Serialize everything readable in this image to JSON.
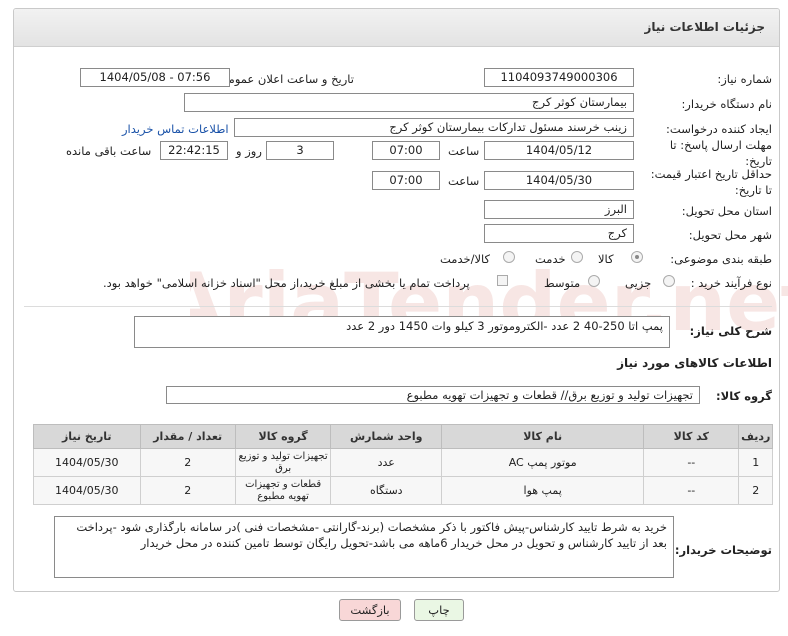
{
  "page": {
    "title": "جزئیات اطلاعات نیاز"
  },
  "fields": {
    "need_number_label": "شماره نیاز:",
    "need_number": "1104093749000306",
    "announce_label": "تاریخ و ساعت اعلان عمومی:",
    "announce_value": "1404/05/08 - 07:56",
    "buyer_org_label": "نام دستگاه خریدار:",
    "buyer_org": "بیمارستان کوثر کرج",
    "creator_label": "ایجاد کننده درخواست:",
    "creator": "زینب خرسند مسئول تدارکات بیمارستان کوثر کرج",
    "contact_link": "اطلاعات تماس خریدار",
    "deadline_label_1": "مهلت ارسال پاسخ: تا",
    "deadline_label_2": "تاریخ:",
    "deadline_date": "1404/05/12",
    "time_label": "ساعت",
    "deadline_time": "07:00",
    "days_value": "3",
    "days_label": "روز و",
    "remaining_time": "22:42:15",
    "remaining_label": "ساعت باقی مانده",
    "min_price_label_1": "حداقل تاریخ اعتبار قیمت:",
    "min_price_label_2": "تا تاریخ:",
    "price_date": "1404/05/30",
    "price_time": "07:00",
    "province_label": "استان محل تحویل:",
    "province": "البرز",
    "city_label": "شهر محل تحویل:",
    "city": "کرج",
    "category_label": "طبقه بندی موضوعی:",
    "category_options": [
      "کالا",
      "خدمت",
      "کالا/خدمت"
    ],
    "process_label": "نوع فرآیند خرید :",
    "process_options": [
      "جزیی",
      "متوسط"
    ],
    "payment_note": "پرداخت تمام یا بخشی از مبلغ خرید،از محل \"اسناد خزانه اسلامی\" خواهد بود."
  },
  "description": {
    "label": "شرح کلی نیاز:",
    "text": "پمپ اتا 250-40 2 عدد -الکتروموتور 3 کیلو وات 1450 دور 2 عدد"
  },
  "goods_info": {
    "heading": "اطلاعات کالاهای مورد نیاز",
    "group_label": "گروه کالا:",
    "group_value": "تجهیزات تولید و توزیع برق//  قطعات و تجهیزات تهویه مطبوع"
  },
  "table": {
    "headers": [
      "ردیف",
      "کد کالا",
      "نام کالا",
      "واحد شمارش",
      "گروه کالا",
      "تعداد / مقدار",
      "تاریخ نیاز"
    ],
    "rows": [
      [
        "1",
        "--",
        "موتور پمپ AC",
        "عدد",
        "تجهیزات تولید و توزیع برق",
        "2",
        "1404/05/30"
      ],
      [
        "2",
        "--",
        "پمپ هوا",
        "دستگاه",
        "قطعات و تجهیزات تهویه مطبوع",
        "2",
        "1404/05/30"
      ]
    ]
  },
  "buyer_notes": {
    "label": "توضیحات خریدار:",
    "text": "خرید به شرط تایید کارشناس-پیش فاکتور با ذکر مشخصات (برند-گارانتی -مشخصات فنی )در سامانه بارگذاری شود -پرداخت بعد از تایید کارشناس و تحویل در محل خریدار 6ماهه می باشد-تحویل رایگان توسط تامین کننده در محل خریدار"
  },
  "buttons": {
    "print": "چاپ",
    "back": "بازگشت"
  },
  "colors": {
    "link": "#1a52a8",
    "back_button_bg": "#f8d7d7",
    "print_button_bg": "#eaf7e4"
  }
}
